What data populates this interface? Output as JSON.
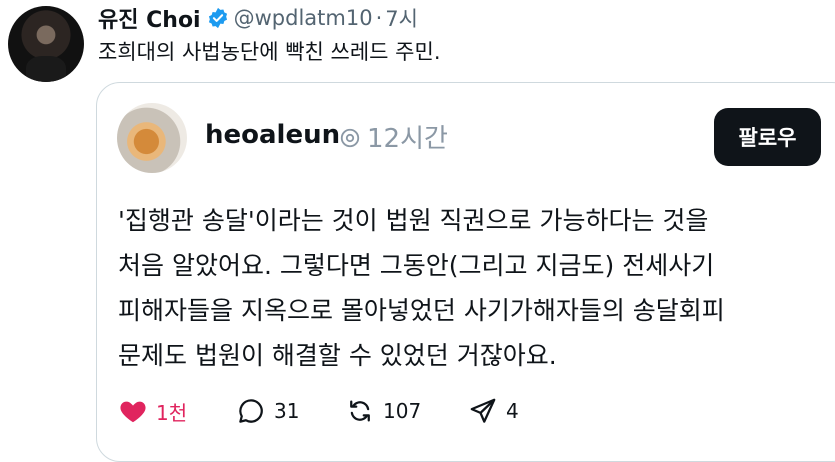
{
  "tweet": {
    "display_name": "유진 Choi",
    "handle": "@wpdlatm10",
    "separator": "·",
    "time": "7시",
    "text": "조희대의 사법농단에 빡친 쓰레드 주민.",
    "verified": true
  },
  "quote": {
    "username": "heoaleun",
    "time": "12시간",
    "follow_label": "팔로우",
    "lines": [
      "'집행관 송달'이라는 것이 법원 직권으로 가능하다는 것을",
      "처음 알았어요. 그렇다면 그동안(그리고 지금도) 전세사기",
      "피해자들을 지옥으로 몰아넣었던 사기가해자들의 송달회피",
      "문제도 법원이 해결할 수 있었던 거잖아요."
    ],
    "actions": {
      "likes": "1천",
      "replies": "31",
      "reposts": "107",
      "shares": "4"
    }
  },
  "colors": {
    "like_red": "#e0245e",
    "verified_blue": "#1d9bf0",
    "border": "#cfd9de",
    "muted": "#536471"
  },
  "icons": [
    "verified-badge-icon",
    "threads-icon",
    "heart-icon",
    "comment-icon",
    "repost-icon",
    "share-icon"
  ]
}
